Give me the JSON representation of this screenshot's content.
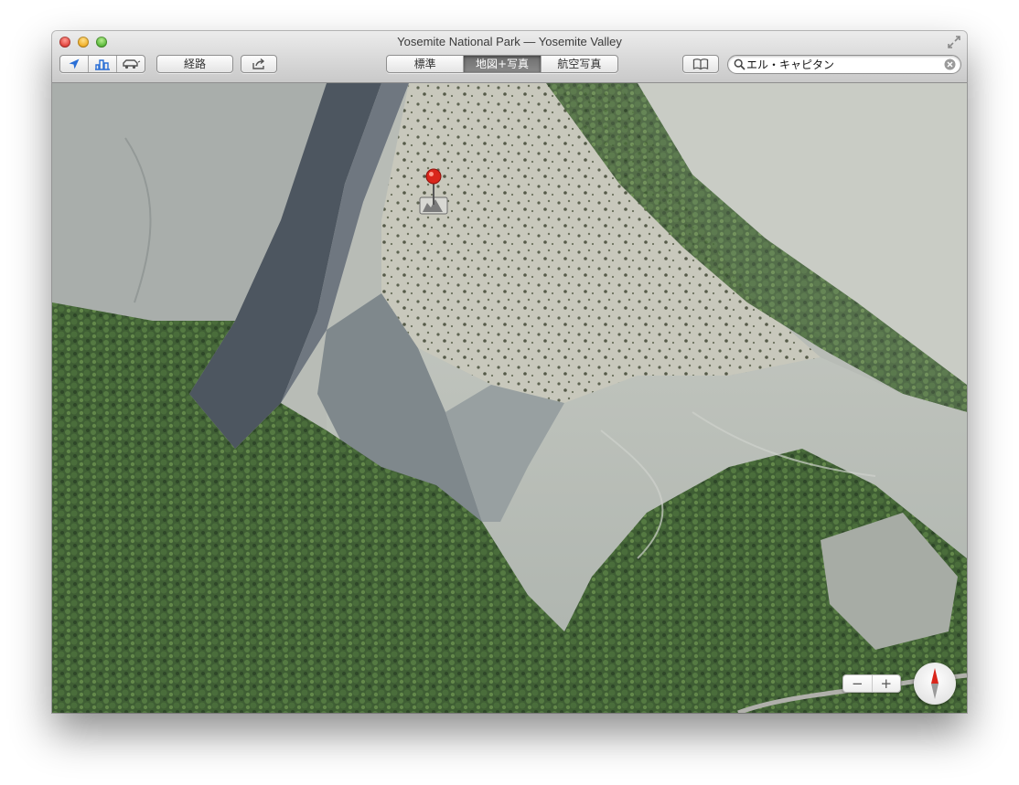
{
  "window": {
    "title": "Yosemite National Park — Yosemite Valley"
  },
  "toolbar": {
    "location_icon": "location-arrow-icon",
    "three_d_icon": "3d-buildings-icon",
    "traffic_icon": "car-icon",
    "directions_label": "経路",
    "share_icon": "share-icon",
    "map_modes": [
      {
        "label": "標準",
        "active": false
      },
      {
        "label": "地図+写真",
        "active": true
      },
      {
        "label": "航空写真",
        "active": false
      }
    ],
    "bookmarks_icon": "open-book-icon"
  },
  "search": {
    "value": "エル・キャピタン",
    "placeholder": ""
  },
  "map": {
    "pin_icon": "red-pin-icon",
    "landmark_icon": "mountain-landmark-icon",
    "zoom_out_label": "−",
    "zoom_in_label": "+",
    "compass_icon": "compass-icon"
  },
  "colors": {
    "accent_blue": "#2a6fd6",
    "pin_red": "#d9261c",
    "segment_active": "#7b7b7b"
  }
}
